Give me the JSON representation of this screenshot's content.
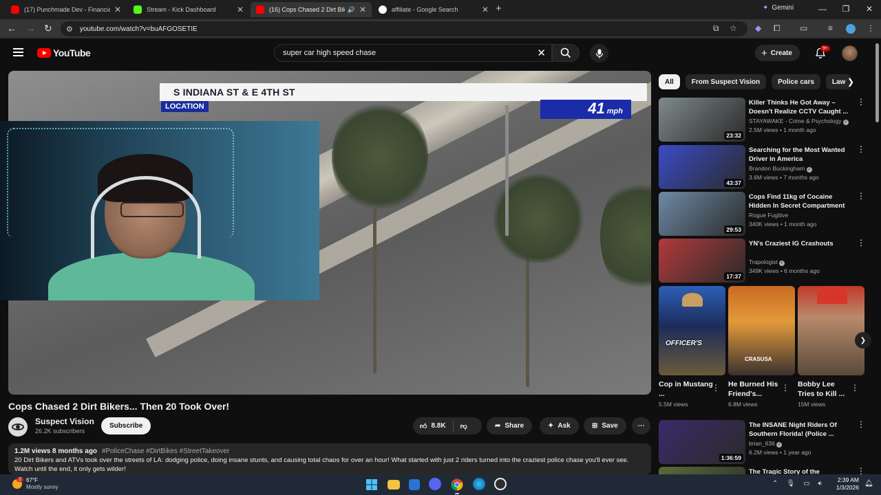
{
  "browser": {
    "tabs": [
      {
        "title": "(17) Punchmade Dev - Financia",
        "color": "#ff0000"
      },
      {
        "title": "Stream - Kick Dashboard",
        "color": "#53fc18"
      },
      {
        "title": "(16) Cops Chased 2 Dirt Bik",
        "color": "#ff0000"
      },
      {
        "title": "affiliate - Google Search",
        "color": "#8ab4f8"
      }
    ],
    "gemini_label": "Gemini",
    "url": "youtube.com/watch?v=buAFGOSETIE"
  },
  "youtube": {
    "logo_text": "YouTube",
    "search_value": "super car high speed chase",
    "create_label": "Create",
    "notification_count": "9+"
  },
  "video": {
    "overlay_street": "S INDIANA ST & E 4TH ST",
    "overlay_location": "LOCATION",
    "overlay_speed": "41",
    "overlay_speed_unit": "mph",
    "title": "Cops Chased 2 Dirt Bikers... Then 20 Took Over!",
    "channel_name": "Suspect Vision",
    "channel_subs": "26.2K subscribers",
    "subscribe_label": "Subscribe",
    "likes": "8.8K",
    "share_label": "Share",
    "ask_label": "Ask",
    "save_label": "Save",
    "desc_meta": "1.2M views  8 months ago",
    "desc_tags": "#PoliceChase #DirtBikes #StreetTakeover",
    "desc_body": "20 Dirt Bikers and ATVs took over the streets of LA: dodging police, doing insane stunts, and causing total chaos for over an hour! What started with just 2 riders turned into the craziest police chase you'll ever see. Watch until the end, it only gets wilder!"
  },
  "sidebar": {
    "chips": [
      "All",
      "From Suspect Vision",
      "Police cars",
      "Law"
    ],
    "recs": [
      {
        "title": "Killer Thinks He Got Away – Doesn't Realize CCTV Caught ...",
        "channel": "STAYAWAKE - Crime & Psychology",
        "stats": "2.5M views • 1 month ago",
        "duration": "23:32",
        "verified": true,
        "thumb": "#7e8a8c"
      },
      {
        "title": "Searching for the Most Wanted Driver in America",
        "channel": "Brandon Buckingham",
        "stats": "3.6M views • 7 months ago",
        "duration": "43:37",
        "verified": true,
        "thumb": "#3a4cc8"
      },
      {
        "title": "Cops Find 11kg of Cocaine Hidden In Secret Compartment",
        "channel": "Rogue Fugitive",
        "stats": "340K views • 1 month ago",
        "duration": "29:53",
        "verified": false,
        "thumb": "#6f8aa6"
      },
      {
        "title": "YN's Craziest IG Crashouts",
        "channel": "Trapologist",
        "stats": "349K views • 6 months ago",
        "duration": "17:37",
        "verified": true,
        "thumb": "#b23a3a"
      }
    ],
    "shorts": [
      {
        "title": "Cop in Mustang ...",
        "views": "5.5M views",
        "overlay": "OFFICER'S",
        "thumb": "#2d5fb8"
      },
      {
        "title": "He Burned His Friend's...",
        "views": "6.8M views",
        "overlay": "CRASUSA",
        "thumb": "#c2611f"
      },
      {
        "title": "Bobby Lee Tries to Kill ...",
        "views": "15M views",
        "overlay": "",
        "thumb": "#7a6a58"
      }
    ],
    "recs_bottom": [
      {
        "title": "The INSANE Night Riders Of Southern Florida! (Police ...",
        "channel": "brian_636",
        "stats": "6.2M views • 1 year ago",
        "duration": "1:36:59",
        "verified": true,
        "thumb": "#3b2a6a"
      },
      {
        "title": "The Tragic Story of the",
        "channel": "",
        "stats": "",
        "duration": "",
        "verified": false,
        "thumb": "#5a6a3a"
      }
    ]
  },
  "taskbar": {
    "temperature": "67°F",
    "condition": "Mostly sunny",
    "weather_badge": "2",
    "time": "2:39 AM",
    "date": "1/3/2026"
  }
}
